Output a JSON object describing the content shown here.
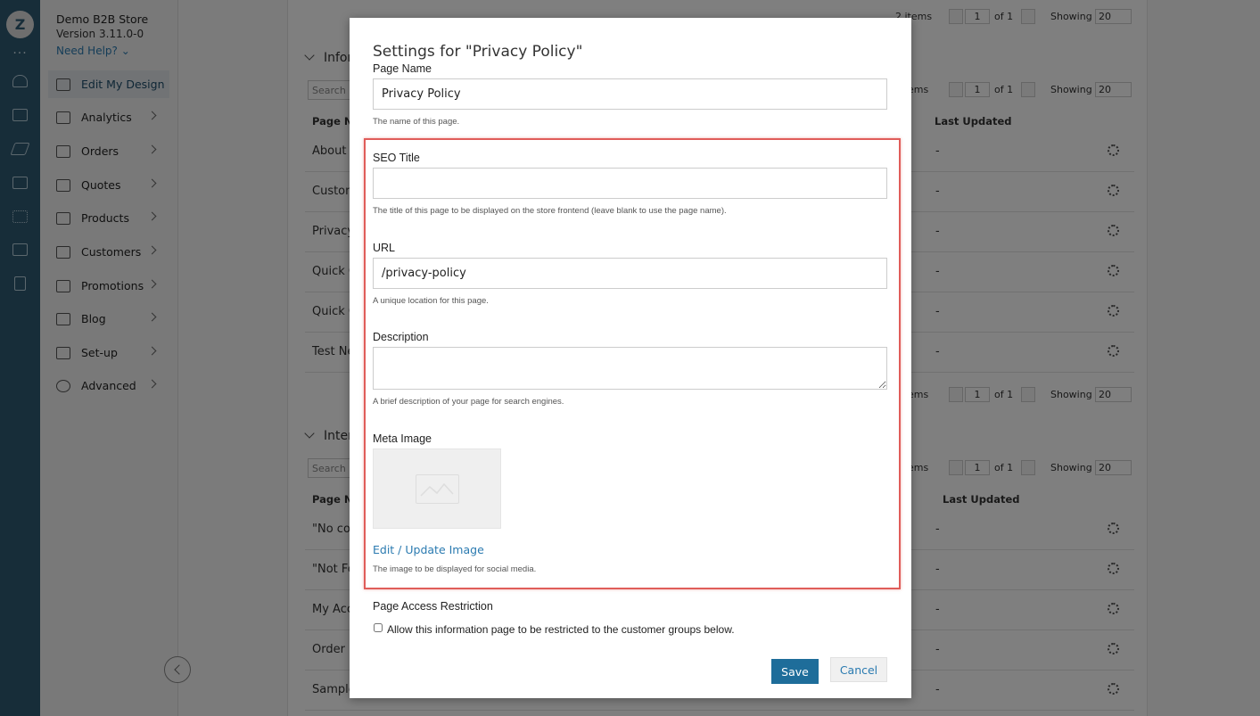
{
  "rail": {
    "logo": "Z",
    "more": "···",
    "icons": [
      "bell-icon",
      "storefront-icon",
      "rocket-icon",
      "news-icon",
      "apps-grid-icon",
      "folder-icon",
      "document-icon"
    ]
  },
  "sidebar": {
    "store_name": "Demo B2B Store",
    "version": "Version 3.11.0-0",
    "help": "Need Help?",
    "items": [
      {
        "label": "Edit My Design",
        "icon": "design-icon",
        "active": true
      },
      {
        "label": "Analytics",
        "icon": "analytics-icon"
      },
      {
        "label": "Orders",
        "icon": "orders-icon"
      },
      {
        "label": "Quotes",
        "icon": "quotes-icon"
      },
      {
        "label": "Products",
        "icon": "products-icon"
      },
      {
        "label": "Customers",
        "icon": "customers-icon"
      },
      {
        "label": "Promotions",
        "icon": "promotions-icon"
      },
      {
        "label": "Blog",
        "icon": "blog-icon"
      },
      {
        "label": "Set-up",
        "icon": "setup-icon"
      },
      {
        "label": "Advanced",
        "icon": "advanced-icon"
      }
    ]
  },
  "background": {
    "top_pager": {
      "items": "2 items",
      "page": "1",
      "of": "of 1",
      "showing": "Showing",
      "per_page": "20"
    },
    "info_section": {
      "title": "Infor",
      "search_placeholder": "Search",
      "col_name": "Page Na",
      "col_updated": "Last Updated",
      "pager": {
        "items": "ems",
        "page": "1",
        "of": "of 1",
        "showing": "Showing",
        "per_page": "20"
      },
      "rows": [
        "About U",
        "Custom",
        "Privacy",
        "Quick O",
        "Quick O",
        "Test Ne"
      ],
      "row_updated": "-",
      "bottom_pager": {
        "items": "ems",
        "page": "1",
        "of": "of 1",
        "showing": "Showing",
        "per_page": "20"
      }
    },
    "internal_section": {
      "title": "Inter",
      "search_placeholder": "Search",
      "col_name": "Page Na",
      "col_updated": "Last Updated",
      "pager": {
        "items": "ems",
        "page": "1",
        "of": "of 1",
        "showing": "Showing",
        "per_page": "20"
      },
      "rows": [
        "\"No coo",
        "\"Not Fo",
        "My Acc",
        "Order S",
        "Sample"
      ],
      "row_updated": "-"
    }
  },
  "modal": {
    "title": "Settings for \"Privacy Policy\"",
    "page_name_label": "Page Name",
    "page_name_value": "Privacy Policy",
    "page_name_help": "The name of this page.",
    "seo_title_label": "SEO Title",
    "seo_title_value": "",
    "seo_title_help": "The title of this page to be displayed on the store frontend (leave blank to use the page name).",
    "url_label": "URL",
    "url_value": "/privacy-policy",
    "url_help": "A unique location for this page.",
    "description_label": "Description",
    "description_value": "",
    "description_help": "A brief description of your page for search engines.",
    "meta_image_label": "Meta Image",
    "edit_image_link": "Edit / Update Image",
    "meta_image_help": "The image to be displayed for social media.",
    "access_label": "Page Access Restriction",
    "access_checkbox_label": "Allow this information page to be restricted to the customer groups below.",
    "access_checked": false,
    "save_label": "Save",
    "cancel_label": "Cancel",
    "highlight_color": "#e05d5a",
    "save_color": "#1e6d9a",
    "link_color": "#2a7ab0"
  }
}
